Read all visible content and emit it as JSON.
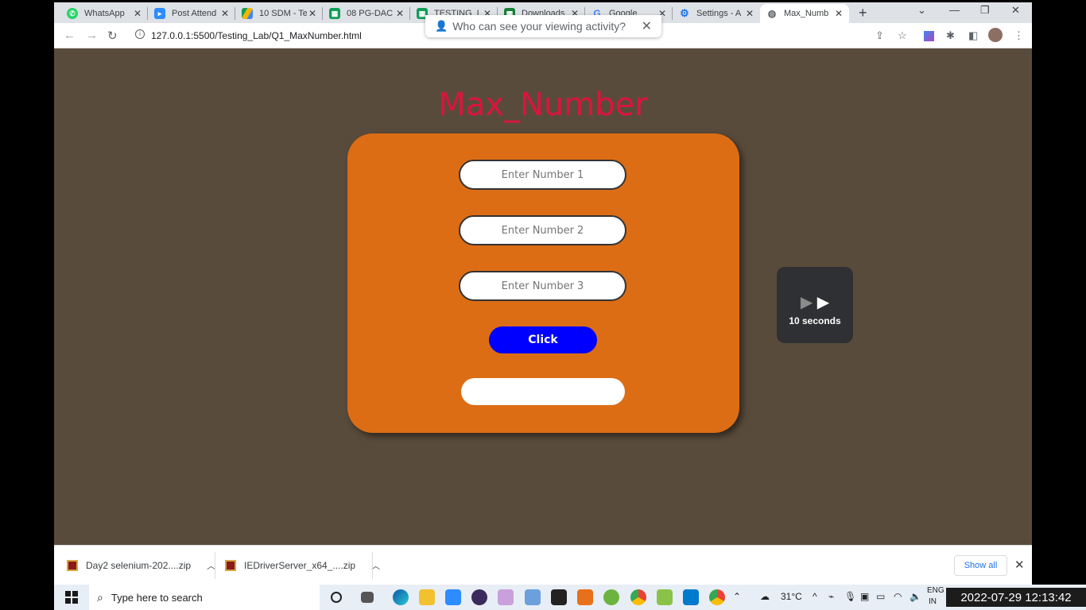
{
  "browser": {
    "tabs": [
      {
        "title": "WhatsApp",
        "icon": "whatsapp-icon",
        "color": "#25d366"
      },
      {
        "title": "Post Attend",
        "icon": "zoom-icon",
        "color": "#2d8cff"
      },
      {
        "title": "10 SDM - Te",
        "icon": "drive-icon",
        "color": "#f4b400"
      },
      {
        "title": "08 PG-DAC",
        "icon": "sheets-icon",
        "color": "#0f9d58"
      },
      {
        "title": "TESTING_LA",
        "icon": "sheets-icon",
        "color": "#0f9d58"
      },
      {
        "title": "Downloads",
        "icon": "sheets-icon",
        "color": "#188038"
      },
      {
        "title": "Google",
        "icon": "google-icon",
        "color": "#ffffff"
      },
      {
        "title": "Settings - A",
        "icon": "gear-icon",
        "color": "#1a73e8"
      },
      {
        "title": "Max_Numb",
        "icon": "globe-icon",
        "color": "#5f6368"
      }
    ],
    "url": "127.0.0.1:5500/Testing_Lab/Q1_MaxNumber.html",
    "popup_text": "Who can see your viewing activity?"
  },
  "page": {
    "heading": "Max_Number",
    "input1_placeholder": "Enter Number 1",
    "input2_placeholder": "Enter Number 2",
    "input3_placeholder": "Enter Number 3",
    "button_label": "Click",
    "result_value": "",
    "overlay_text": "10 seconds",
    "colors": {
      "background": "#594b3b",
      "card": "#dc6d15",
      "heading": "#dc143c",
      "button": "#0000ff"
    }
  },
  "downloads": {
    "items": [
      "Day2 selenium-202....zip",
      "IEDriverServer_x64_....zip"
    ],
    "show_all": "Show all"
  },
  "taskbar": {
    "search_placeholder": "Type here to search",
    "temperature": "31°C",
    "lang": "ENG",
    "region": "IN",
    "clock": "2022-07-29 12:13:42"
  }
}
